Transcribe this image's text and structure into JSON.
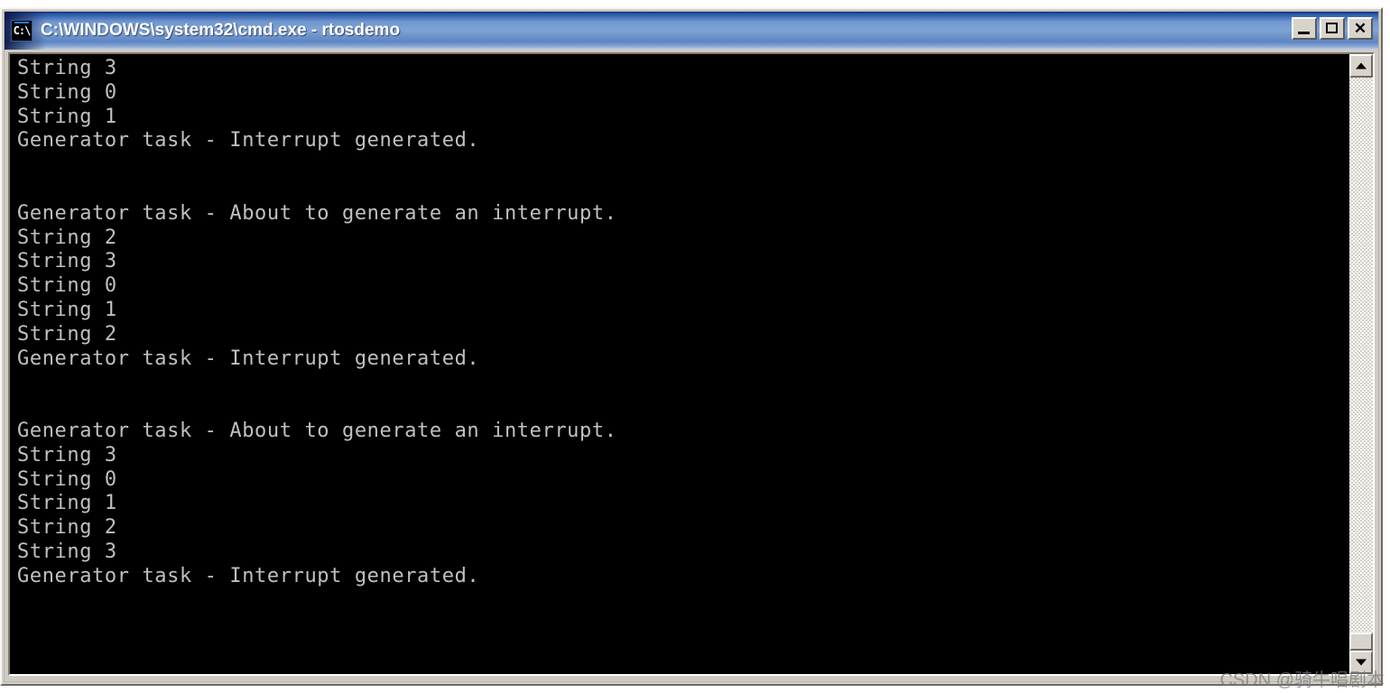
{
  "window": {
    "title": "C:\\WINDOWS\\system32\\cmd.exe - rtosdemo",
    "icon_label": "C:\\",
    "icon_name": "cmd-console-icon",
    "titlebar_color": "#5d86c4",
    "titlebar_text_color": "#ffffff"
  },
  "window_controls": {
    "minimize_label": "Minimize",
    "maximize_label": "Maximize",
    "close_label": "✕",
    "close_tooltip": "Close"
  },
  "console": {
    "background_color": "#000000",
    "text_color": "#c0c0c0",
    "lines": [
      "String 3",
      "String 0",
      "String 1",
      "Generator task - Interrupt generated.",
      "",
      "",
      "Generator task - About to generate an interrupt.",
      "String 2",
      "String 3",
      "String 0",
      "String 1",
      "String 2",
      "Generator task - Interrupt generated.",
      "",
      "",
      "Generator task - About to generate an interrupt.",
      "String 3",
      "String 0",
      "String 1",
      "String 2",
      "String 3",
      "Generator task - Interrupt generated.",
      "",
      "",
      "",
      ""
    ]
  },
  "scrollbar": {
    "up_arrow_label": "▲",
    "down_arrow_label": "▼",
    "orientation": "vertical",
    "thumb_position": "bottom"
  },
  "watermark": {
    "text": "CSDN @骑牛唱剧本"
  }
}
